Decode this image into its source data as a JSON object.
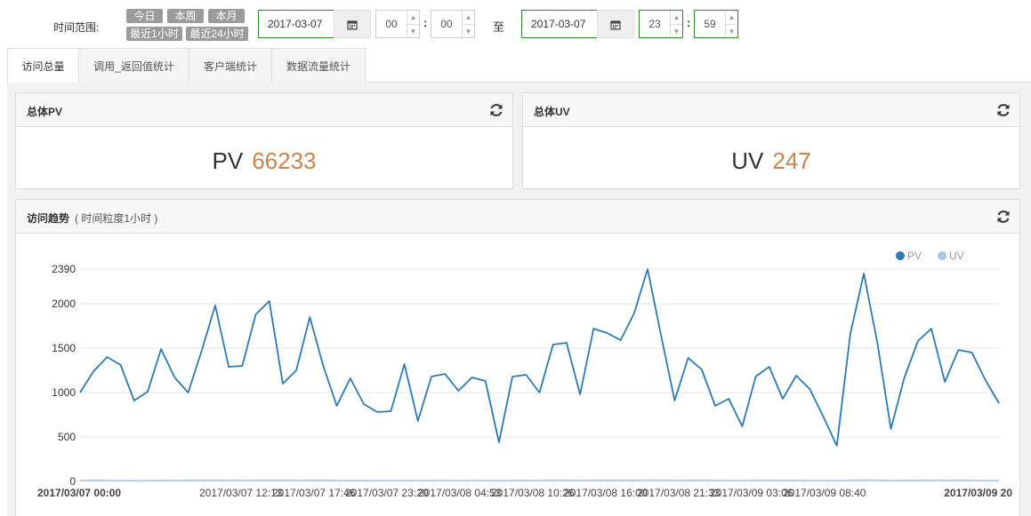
{
  "timerange": {
    "label": "时间范围:",
    "quick": [
      "今日",
      "本周",
      "本月",
      "最近1小时",
      "最近24小时"
    ],
    "start_date": "2017-03-07",
    "start_hour": "00",
    "start_min": "00",
    "to_label": "至",
    "end_date": "2017-03-07",
    "end_hour": "23",
    "end_min": "59"
  },
  "tabs": [
    {
      "label": "访问总量",
      "active": true
    },
    {
      "label": "调用_返回值统计",
      "active": false
    },
    {
      "label": "客户端统计",
      "active": false
    },
    {
      "label": "数据流量统计",
      "active": false
    }
  ],
  "pv_panel": {
    "title": "总体PV",
    "label": "PV",
    "value": "66233"
  },
  "uv_panel": {
    "title": "总体UV",
    "label": "UV",
    "value": "247"
  },
  "trend_panel": {
    "title": "访问趋势",
    "subtitle": "( 时间粒度1小时 )"
  },
  "colors": {
    "pv": "#2b7ab5",
    "uv": "#a9c8e8",
    "stat_value": "#c8844a",
    "active_border": "#2a8a2a"
  },
  "icons": {
    "calendar": "calendar-icon",
    "refresh": "refresh-icon"
  },
  "chart_data": {
    "type": "line",
    "ylim": [
      0,
      2390
    ],
    "yticks": [
      "0",
      "500",
      "1000",
      "1500",
      "2000",
      "2390"
    ],
    "xticks": [
      "2017/03/07 00:00",
      "2017/03/07 12:13",
      "2017/03/07 17:46",
      "2017/03/07 23:20",
      "2017/03/08 04:53",
      "2017/03/08 10:26",
      "2017/03/08 16:00",
      "2017/03/08 21:33",
      "2017/03/09 03:06",
      "2017/03/09 08:40",
      "2017/03/09 20"
    ],
    "legend": [
      "PV",
      "UV"
    ],
    "legend_position": "top-right",
    "grid": true,
    "series": [
      {
        "name": "PV",
        "values": [
          1000,
          1240,
          1400,
          1310,
          910,
          1010,
          1490,
          1170,
          1000,
          1470,
          1980,
          1290,
          1300,
          1880,
          2030,
          1100,
          1250,
          1850,
          1300,
          850,
          1160,
          870,
          780,
          790,
          1320,
          680,
          1180,
          1210,
          1020,
          1170,
          1130,
          440,
          1180,
          1200,
          1000,
          1540,
          1560,
          980,
          1720,
          1670,
          1590,
          1890,
          2390,
          1640,
          910,
          1390,
          1260,
          850,
          930,
          620,
          1180,
          1290,
          930,
          1190,
          1040,
          730,
          400,
          1660,
          2340,
          1560,
          590,
          1170,
          1580,
          1720,
          1120,
          1480,
          1450,
          1140,
          880
        ]
      },
      {
        "name": "UV",
        "values": [
          10,
          11,
          10,
          9,
          8,
          9,
          10,
          11,
          12,
          13,
          14,
          12,
          11,
          12,
          14,
          13,
          11,
          12,
          12,
          10,
          9,
          10,
          9,
          9,
          10,
          9,
          10,
          10,
          9,
          10,
          10,
          8,
          10,
          11,
          10,
          11,
          12,
          11,
          12,
          13,
          12,
          13,
          15,
          14,
          11,
          12,
          12,
          10,
          10,
          9,
          11,
          12,
          10,
          11,
          10,
          9,
          8,
          12,
          15,
          14,
          9,
          10,
          11,
          12,
          11,
          12,
          11,
          10,
          9
        ]
      }
    ]
  }
}
